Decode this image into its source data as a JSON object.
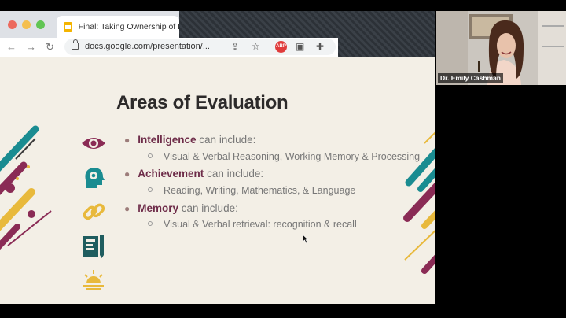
{
  "browser": {
    "tab_title": "Final: Taking Ownership of L",
    "url": "docs.google.com/presentation/...",
    "traffic_lights": {
      "close": "#ec6a5e",
      "minimize": "#f4bf4f",
      "maximize": "#61c554"
    },
    "icons": [
      "back-arrow-icon",
      "forward-arrow-icon",
      "reload-icon",
      "lock-icon",
      "share-icon",
      "star-icon",
      "adblock-icon",
      "extension-puzzle-icon"
    ],
    "adblock_label": "ABP"
  },
  "slide": {
    "title": "Areas of Evaluation",
    "items": [
      {
        "keyword": "Intelligence",
        "rest": "can include:",
        "sub": "Visual & Verbal Reasoning, Working Memory & Processing"
      },
      {
        "keyword": "Achievement",
        "rest": "can include:",
        "sub": "Reading, Writing, Mathematics, & Language"
      },
      {
        "keyword": "Memory",
        "rest": "can include:",
        "sub": "Visual & Verbal retrieval: recognition & recall"
      }
    ],
    "side_icons": [
      "eye-icon",
      "head-gear-icon",
      "chain-link-icon",
      "book-pencil-icon",
      "sunrise-icon"
    ],
    "colors": {
      "keyword": "#6e2c49",
      "teal": "#1a8c91",
      "gold": "#e8b93c",
      "plum": "#8a2b55"
    }
  },
  "video": {
    "participant_name": "Dr. Emily Cashman"
  }
}
